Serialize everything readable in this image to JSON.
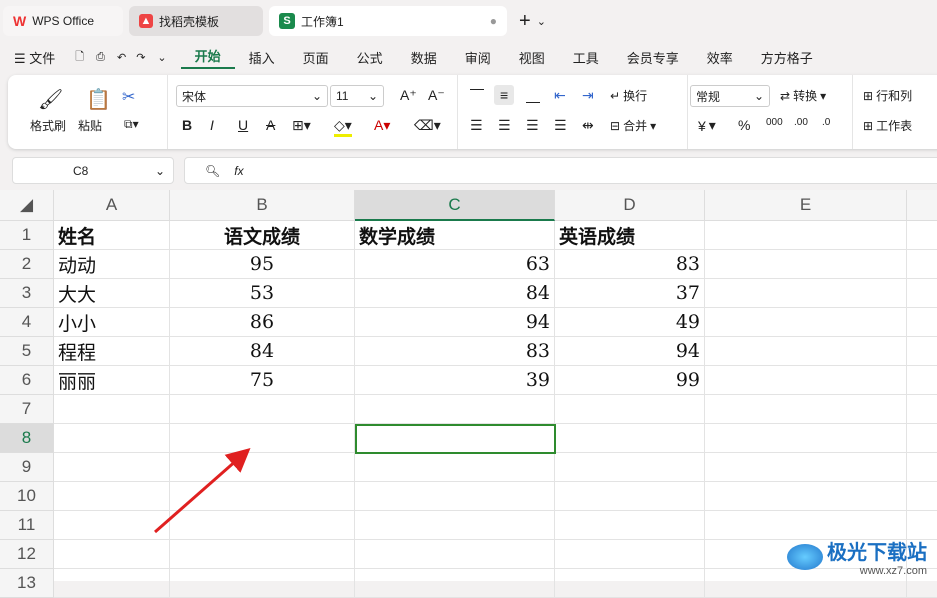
{
  "tabs": [
    {
      "label": "WPS Office"
    },
    {
      "label": "找稻壳模板"
    },
    {
      "label": "工作簿1"
    }
  ],
  "menu": {
    "file": "文件",
    "items": [
      "开始",
      "插入",
      "页面",
      "公式",
      "数据",
      "审阅",
      "视图",
      "工具",
      "会员专享",
      "效率",
      "方方格子"
    ]
  },
  "ribbon": {
    "format_painter": "格式刷",
    "paste": "粘贴",
    "font": "宋体",
    "size": "11",
    "wrap": "换行",
    "merge": "合并",
    "number_format": "常规",
    "convert": "转换",
    "rowcol": "行和列",
    "sheet": "工作表",
    "currency": "¥",
    "percent": "%"
  },
  "formula_bar": {
    "cell_ref": "C8",
    "fx": "fx",
    "value": ""
  },
  "columns": [
    "A",
    "B",
    "C",
    "D",
    "E"
  ],
  "rows": [
    "1",
    "2",
    "3",
    "4",
    "5",
    "6",
    "7",
    "8",
    "9",
    "10",
    "11",
    "12",
    "13"
  ],
  "table": {
    "headers": [
      "姓名",
      "语文成绩",
      "数学成绩",
      "英语成绩"
    ],
    "data": [
      [
        "动动",
        "95",
        "63",
        "83"
      ],
      [
        "大大",
        "53",
        "84",
        "37"
      ],
      [
        "小小",
        "86",
        "94",
        "49"
      ],
      [
        "程程",
        "84",
        "83",
        "94"
      ],
      [
        "丽丽",
        "75",
        "39",
        "99"
      ]
    ]
  },
  "watermark": {
    "name": "极光下载站",
    "url": "www.xz7.com"
  },
  "colors": {
    "accent": "#1a7a4c",
    "selection": "#2e8b2e",
    "arrow": "#e02020"
  }
}
